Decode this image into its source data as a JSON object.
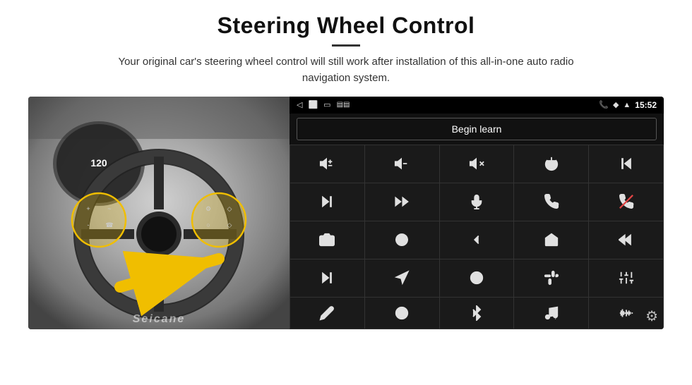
{
  "page": {
    "title": "Steering Wheel Control",
    "subtitle": "Your original car's steering wheel control will still work after installation of this all-in-one auto radio navigation system.",
    "divider_color": "#333"
  },
  "status_bar": {
    "time": "15:52",
    "icons": [
      "back-arrow",
      "home",
      "recents",
      "sd-card",
      "signal"
    ],
    "right_icons": [
      "phone-icon",
      "location-icon",
      "wifi-icon",
      "time-label"
    ]
  },
  "begin_learn": {
    "label": "Begin learn"
  },
  "icon_grid": {
    "cells": [
      {
        "id": "vol-up",
        "symbol": "vol+"
      },
      {
        "id": "vol-down",
        "symbol": "vol-"
      },
      {
        "id": "mute",
        "symbol": "mute"
      },
      {
        "id": "power",
        "symbol": "pwr"
      },
      {
        "id": "prev-track",
        "symbol": "prev"
      },
      {
        "id": "next",
        "symbol": "next"
      },
      {
        "id": "fast-forward",
        "symbol": "ff"
      },
      {
        "id": "mic",
        "symbol": "mic"
      },
      {
        "id": "phone",
        "symbol": "phone"
      },
      {
        "id": "hang-up",
        "symbol": "hang"
      },
      {
        "id": "cam",
        "symbol": "cam"
      },
      {
        "id": "360",
        "symbol": "360"
      },
      {
        "id": "back",
        "symbol": "back"
      },
      {
        "id": "home2",
        "symbol": "home"
      },
      {
        "id": "rewind",
        "symbol": "rew"
      },
      {
        "id": "skip-fwd",
        "symbol": "skipf"
      },
      {
        "id": "navigate",
        "symbol": "nav"
      },
      {
        "id": "swap",
        "symbol": "swap"
      },
      {
        "id": "record",
        "symbol": "rec"
      },
      {
        "id": "equalizer",
        "symbol": "eq"
      },
      {
        "id": "pen",
        "symbol": "pen"
      },
      {
        "id": "power2",
        "symbol": "pwr2"
      },
      {
        "id": "bluetooth",
        "symbol": "bt"
      },
      {
        "id": "music",
        "symbol": "music"
      },
      {
        "id": "waveform",
        "symbol": "wave"
      }
    ]
  },
  "watermark": "Seicane",
  "gear_label": "⚙"
}
